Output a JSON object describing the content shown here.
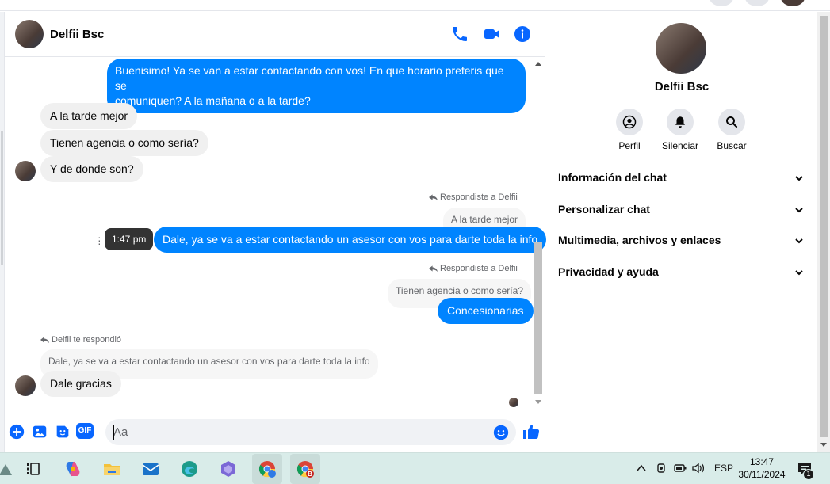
{
  "chat": {
    "contact_name": "Delfii Bsc",
    "messages": {
      "out1_line1": "Buenisimo! Ya se van a estar contactando con vos! En que horario preferis que se",
      "out1_line2": "comuniquen? A la mañana o a la tarde?",
      "in1": "A la tarde mejor",
      "in2": "Tienen agencia o como sería?",
      "in3": "Y de donde son?",
      "reply_note_1": "Respondiste a Delfii",
      "quoted_1": "A la tarde mejor",
      "out2": "Dale, ya se va a estar contactando un asesor con vos para darte toda la info",
      "time_badge": "1:47 pm",
      "reply_note_2": "Respondiste a Delfii",
      "quoted_2": "Tienen agencia o como sería?",
      "out3": "Concesionarias",
      "reply_note_3": "Delfii te respondió",
      "quoted_3": "Dale, ya se va a estar contactando un asesor con vos para darte toda la info",
      "in4": "Dale gracias"
    },
    "composer": {
      "placeholder": "Aa",
      "gif_label": "GIF"
    }
  },
  "info_panel": {
    "name": "Delfii Bsc",
    "actions": {
      "profile": "Perfil",
      "mute": "Silenciar",
      "search": "Buscar"
    },
    "sections": {
      "chat_info": "Información del chat",
      "customize": "Personalizar chat",
      "media": "Multimedia, archivos y enlaces",
      "privacy": "Privacidad y ayuda"
    }
  },
  "taskbar": {
    "language": "ESP",
    "time": "13:47",
    "date": "30/11/2024",
    "notification_count": "1",
    "chrome_badge": "B"
  },
  "colors": {
    "accent": "#0084ff",
    "icon_blue": "#0866ff",
    "incoming_bg": "#f0f0f0",
    "taskbar_bg": "#d9ece9"
  },
  "icons": {
    "header": [
      "phone-icon",
      "video-camera-icon",
      "info-icon"
    ],
    "composer": [
      "plus-icon",
      "image-icon",
      "sticker-icon",
      "gif-icon",
      "emoji-icon",
      "like-icon"
    ],
    "taskbar": [
      "task-view-icon",
      "copilot-icon",
      "file-explorer-icon",
      "mail-icon",
      "edge-icon",
      "teams-icon",
      "chrome-icon",
      "chrome-profile-icon"
    ]
  }
}
